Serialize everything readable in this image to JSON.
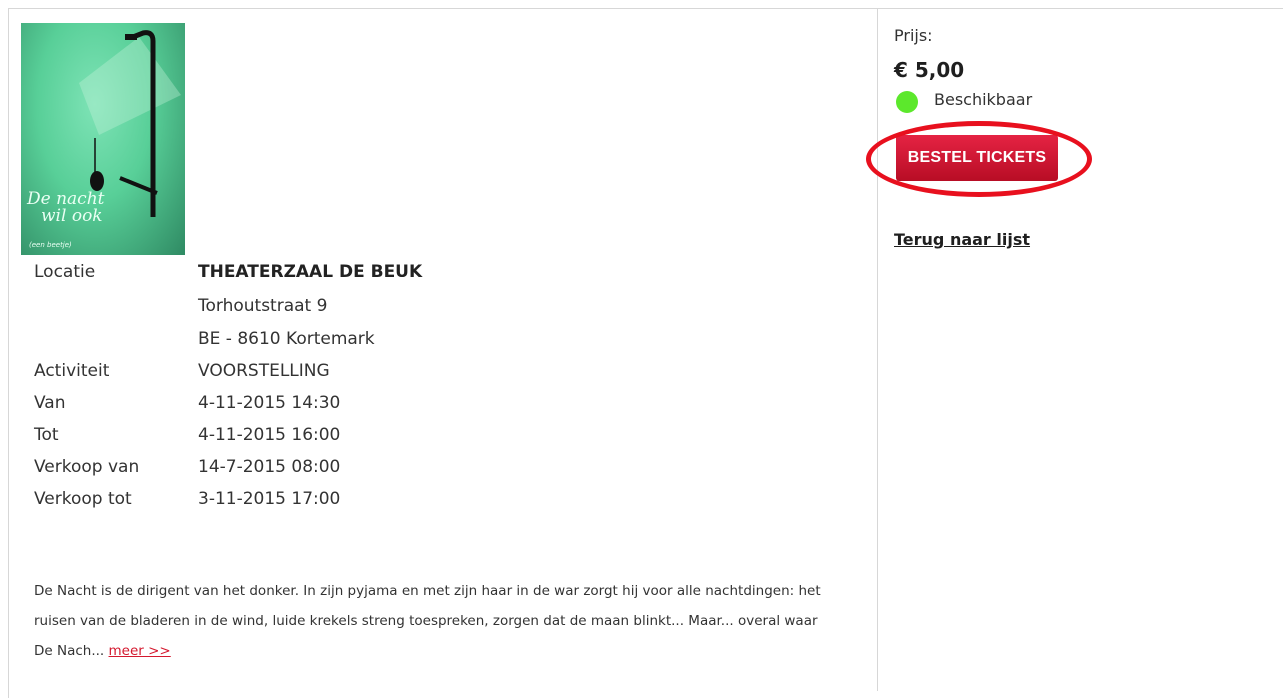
{
  "event": {
    "poster": {
      "title_line1": "De nacht",
      "title_line2": "wil ook",
      "subtitle": "(een beetje)"
    },
    "details": [
      {
        "label": "Locatie",
        "value": "THEATERZAAL DE BEUK"
      },
      {
        "label": "",
        "value": "Torhoutstraat 9"
      },
      {
        "label": "",
        "value": "BE - 8610 Kortemark"
      },
      {
        "label": "Activiteit",
        "value": "VOORSTELLING"
      },
      {
        "label": "Van",
        "value": "4-11-2015 14:30"
      },
      {
        "label": "Tot",
        "value": "4-11-2015 16:00"
      },
      {
        "label": "Verkoop van",
        "value": "14-7-2015 08:00"
      },
      {
        "label": "Verkoop tot",
        "value": "3-11-2015 17:00"
      }
    ],
    "description": "De Nacht is de dirigent van het donker. In zijn pyjama en met zijn haar in de war zorgt hij voor alle nachtdingen: het ruisen van de bladeren in de wind, luide krekels streng toespreken, zorgen dat de maan blinkt... Maar... overal waar De Nach...",
    "more_link": "meer >>"
  },
  "sidebar": {
    "price_label": "Prijs:",
    "price": "€ 5,00",
    "availability": "Beschikbaar",
    "availability_color": "#5ce82c",
    "order_button": "BESTEL TICKETS",
    "back_link": "Terug naar lijst"
  },
  "colors": {
    "accent": "#d4192f",
    "highlight_ring": "#e8101e",
    "poster_green": "#58cf98"
  }
}
